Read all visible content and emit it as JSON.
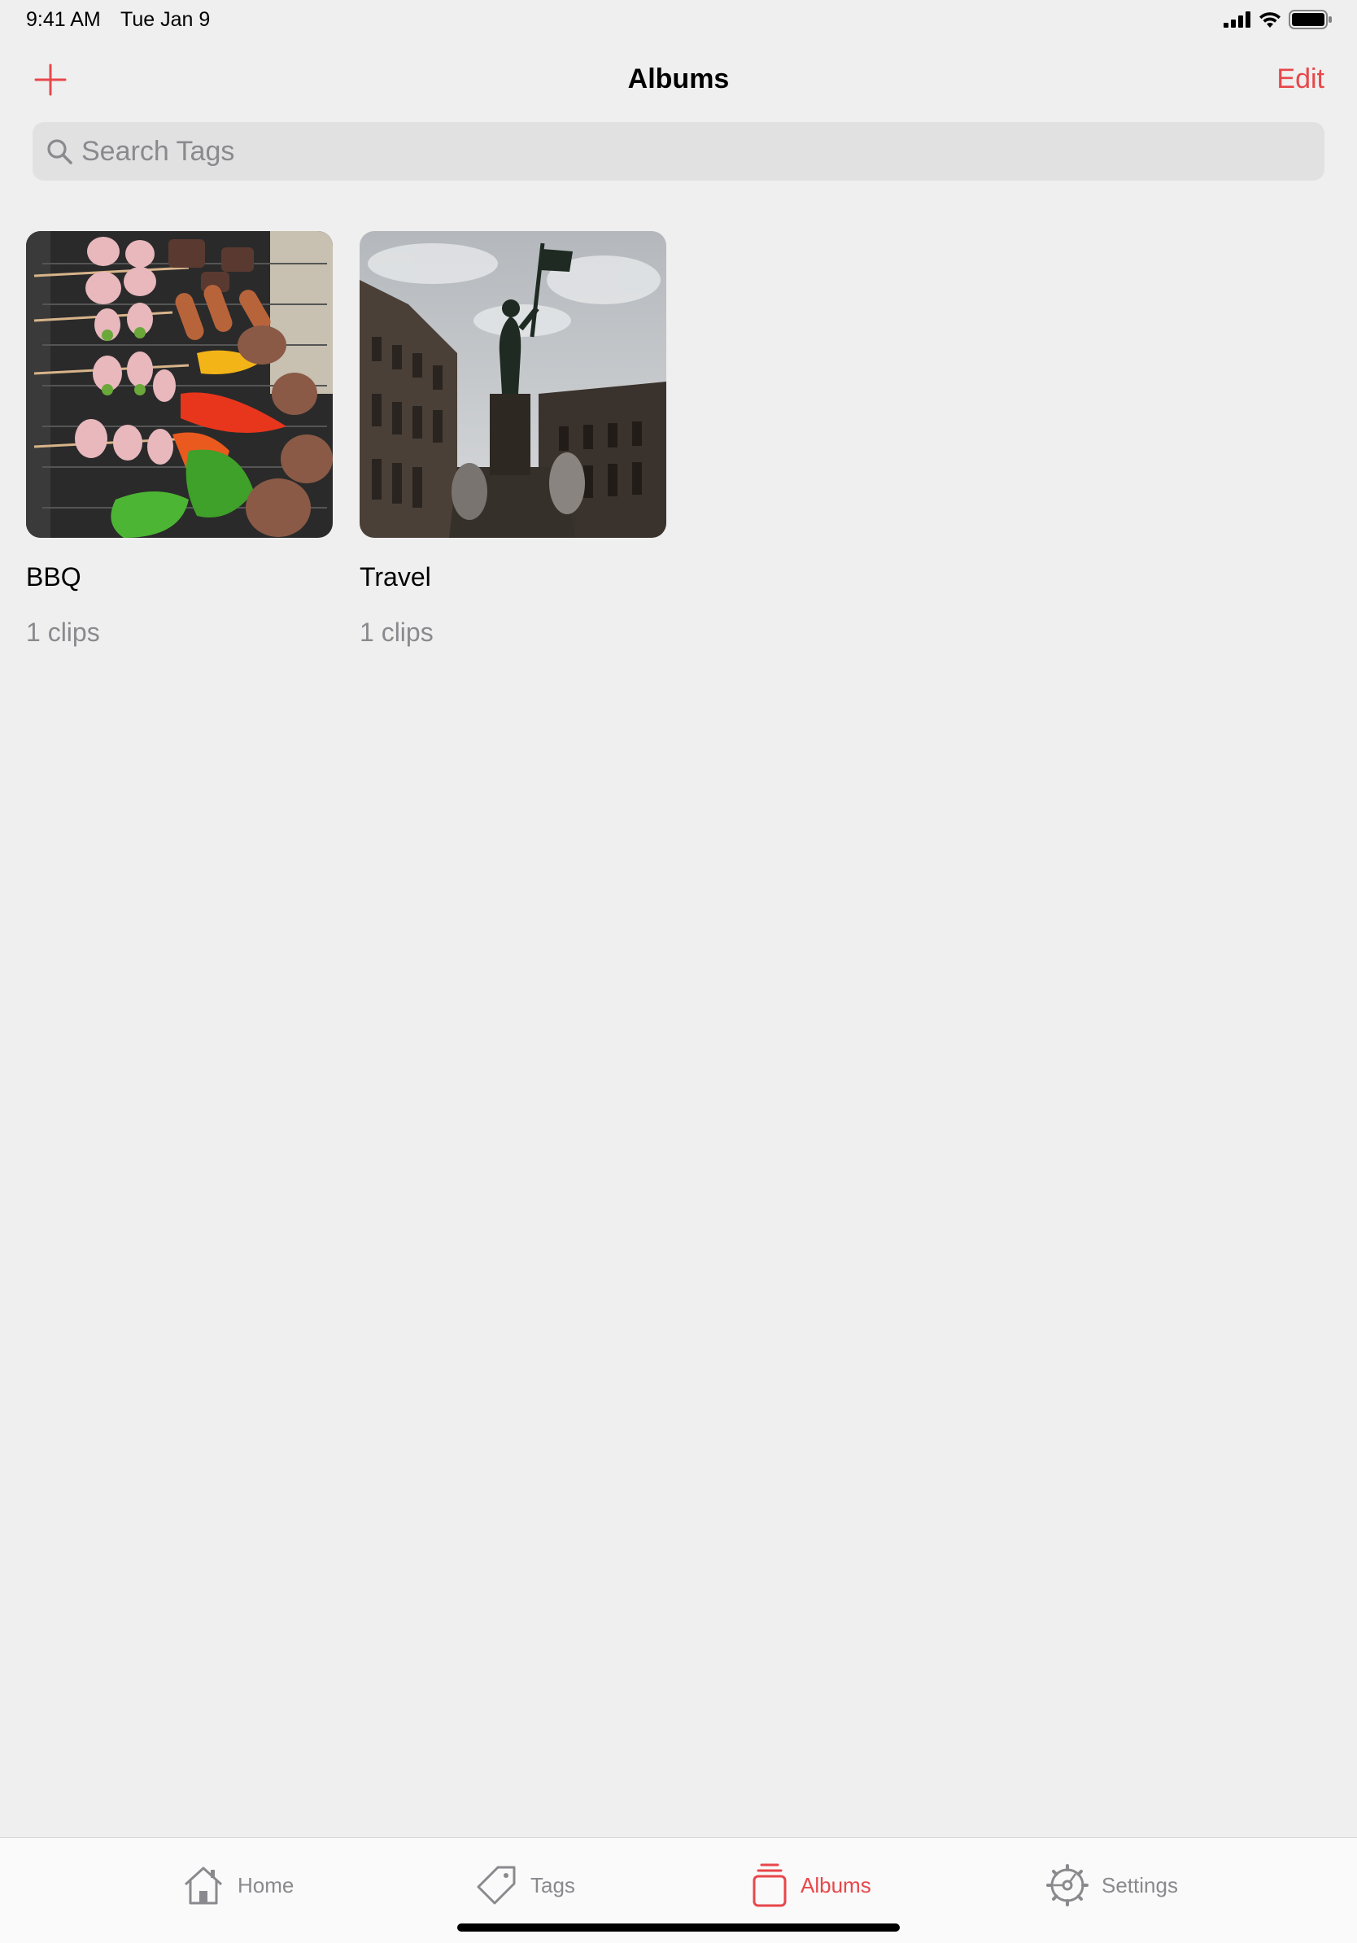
{
  "status_bar": {
    "time": "9:41 AM",
    "date": "Tue Jan 9",
    "icons": [
      "cellular-signal-icon",
      "wifi-icon",
      "battery-icon"
    ]
  },
  "nav": {
    "title": "Albums",
    "edit_label": "Edit",
    "add_icon": "plus-icon"
  },
  "search": {
    "placeholder": "Search Tags",
    "value": ""
  },
  "albums": [
    {
      "name": "BBQ",
      "count": "1 clips"
    },
    {
      "name": "Travel",
      "count": "1 clips"
    }
  ],
  "tabs": [
    {
      "label": "Home",
      "icon": "house-icon",
      "active": false
    },
    {
      "label": "Tags",
      "icon": "tag-icon",
      "active": false
    },
    {
      "label": "Albums",
      "icon": "albums-icon",
      "active": true
    },
    {
      "label": "Settings",
      "icon": "gear-icon",
      "active": false
    }
  ],
  "colors": {
    "accent": "#e8474a",
    "background": "#efefef",
    "secondary_text": "#8a8a8e"
  }
}
